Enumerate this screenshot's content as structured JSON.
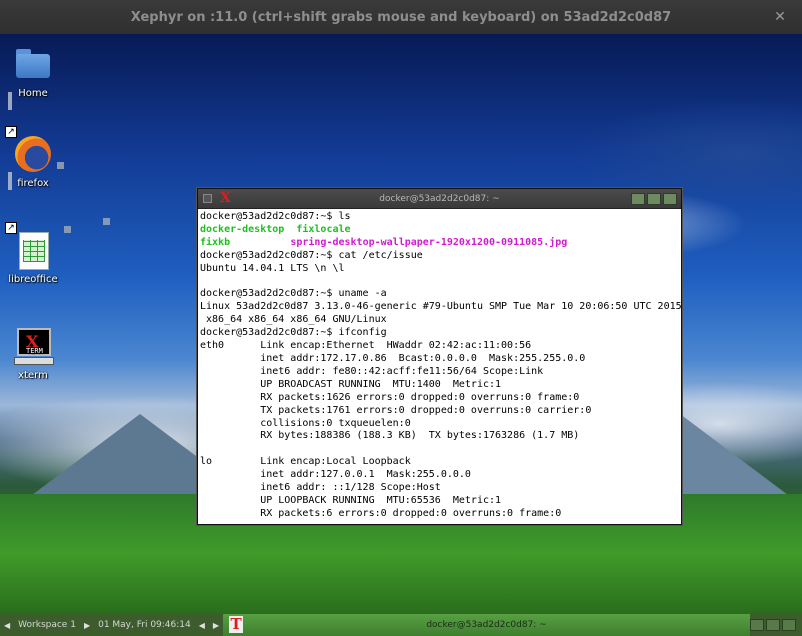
{
  "outer_window": {
    "title": "Xephyr on :11.0 (ctrl+shift grabs mouse and keyboard) on 53ad2d2c0d87",
    "close_glyph": "✕"
  },
  "desktop_icons": [
    {
      "label": "Home",
      "icon": "folder-icon"
    },
    {
      "label": "firefox",
      "icon": "firefox-icon"
    },
    {
      "label": "libreoffice",
      "icon": "libreoffice-calc-icon"
    },
    {
      "label": "xterm",
      "icon": "xterm-icon",
      "glyph_top": "X",
      "glyph_bottom": "TERM"
    }
  ],
  "xterm": {
    "title": "docker@53ad2d2c0d87: ~",
    "icon_glyph": "X",
    "lines": {
      "l1": "docker@53ad2d2c0d87:~$ ls",
      "l2a": "docker-desktop",
      "l2b": "fixlocale",
      "l3a": "fixkb",
      "l3b": "spring-desktop-wallpaper-1920x1200-0911085.jpg",
      "l4": "docker@53ad2d2c0d87:~$ cat /etc/issue",
      "l5": "Ubuntu 14.04.1 LTS \\n \\l",
      "l6": "",
      "l7": "docker@53ad2d2c0d87:~$ uname -a",
      "l8": "Linux 53ad2d2c0d87 3.13.0-46-generic #79-Ubuntu SMP Tue Mar 10 20:06:50 UTC 2015",
      "l9": " x86_64 x86_64 x86_64 GNU/Linux",
      "l10": "docker@53ad2d2c0d87:~$ ifconfig",
      "l11": "eth0      Link encap:Ethernet  HWaddr 02:42:ac:11:00:56",
      "l12": "          inet addr:172.17.0.86  Bcast:0.0.0.0  Mask:255.255.0.0",
      "l13": "          inet6 addr: fe80::42:acff:fe11:56/64 Scope:Link",
      "l14": "          UP BROADCAST RUNNING  MTU:1400  Metric:1",
      "l15": "          RX packets:1626 errors:0 dropped:0 overruns:0 frame:0",
      "l16": "          TX packets:1761 errors:0 dropped:0 overruns:0 carrier:0",
      "l17": "          collisions:0 txqueuelen:0",
      "l18": "          RX bytes:188386 (188.3 KB)  TX bytes:1763286 (1.7 MB)",
      "l19": "",
      "l20": "lo        Link encap:Local Loopback",
      "l21": "          inet addr:127.0.0.1  Mask:255.0.0.0",
      "l22": "          inet6 addr: ::1/128 Scope:Host",
      "l23": "          UP LOOPBACK RUNNING  MTU:65536  Metric:1",
      "l24": "          RX packets:6 errors:0 dropped:0 overruns:0 frame:0"
    }
  },
  "taskbar": {
    "prev_arrow": "◀",
    "workspace": "Workspace 1",
    "next_arrow": "▶",
    "datetime": "01 May, Fri 09:46:14",
    "active_task_icon": "T",
    "active_task_title": "docker@53ad2d2c0d87: ~"
  },
  "colors": {
    "ls_dir": "#1fbf1f",
    "ls_image": "#d21ad2",
    "taskbar_bg": "#3c5c2c",
    "taskbar_active": "#58a043"
  }
}
